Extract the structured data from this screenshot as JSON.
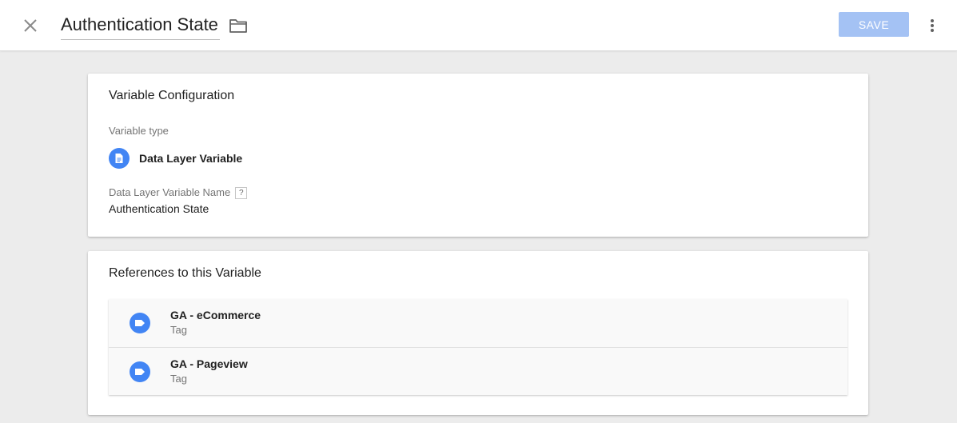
{
  "header": {
    "title": "Authentication State",
    "save_label": "SAVE",
    "close_icon": "close-icon",
    "folder_icon": "folder-icon",
    "more_icon": "more-vert-icon"
  },
  "config": {
    "card_title": "Variable Configuration",
    "type_label": "Variable type",
    "type_name": "Data Layer Variable",
    "type_icon": "document-icon",
    "name_label": "Data Layer Variable Name",
    "help_glyph": "?",
    "name_value": "Authentication State"
  },
  "references": {
    "card_title": "References to this Variable",
    "items": [
      {
        "name": "GA - eCommerce",
        "type": "Tag",
        "icon": "tag-icon"
      },
      {
        "name": "GA - Pageview",
        "type": "Tag",
        "icon": "tag-icon"
      }
    ]
  },
  "colors": {
    "accent": "#4285f4",
    "save_disabled": "#a4c2f4",
    "background": "#ececec"
  }
}
